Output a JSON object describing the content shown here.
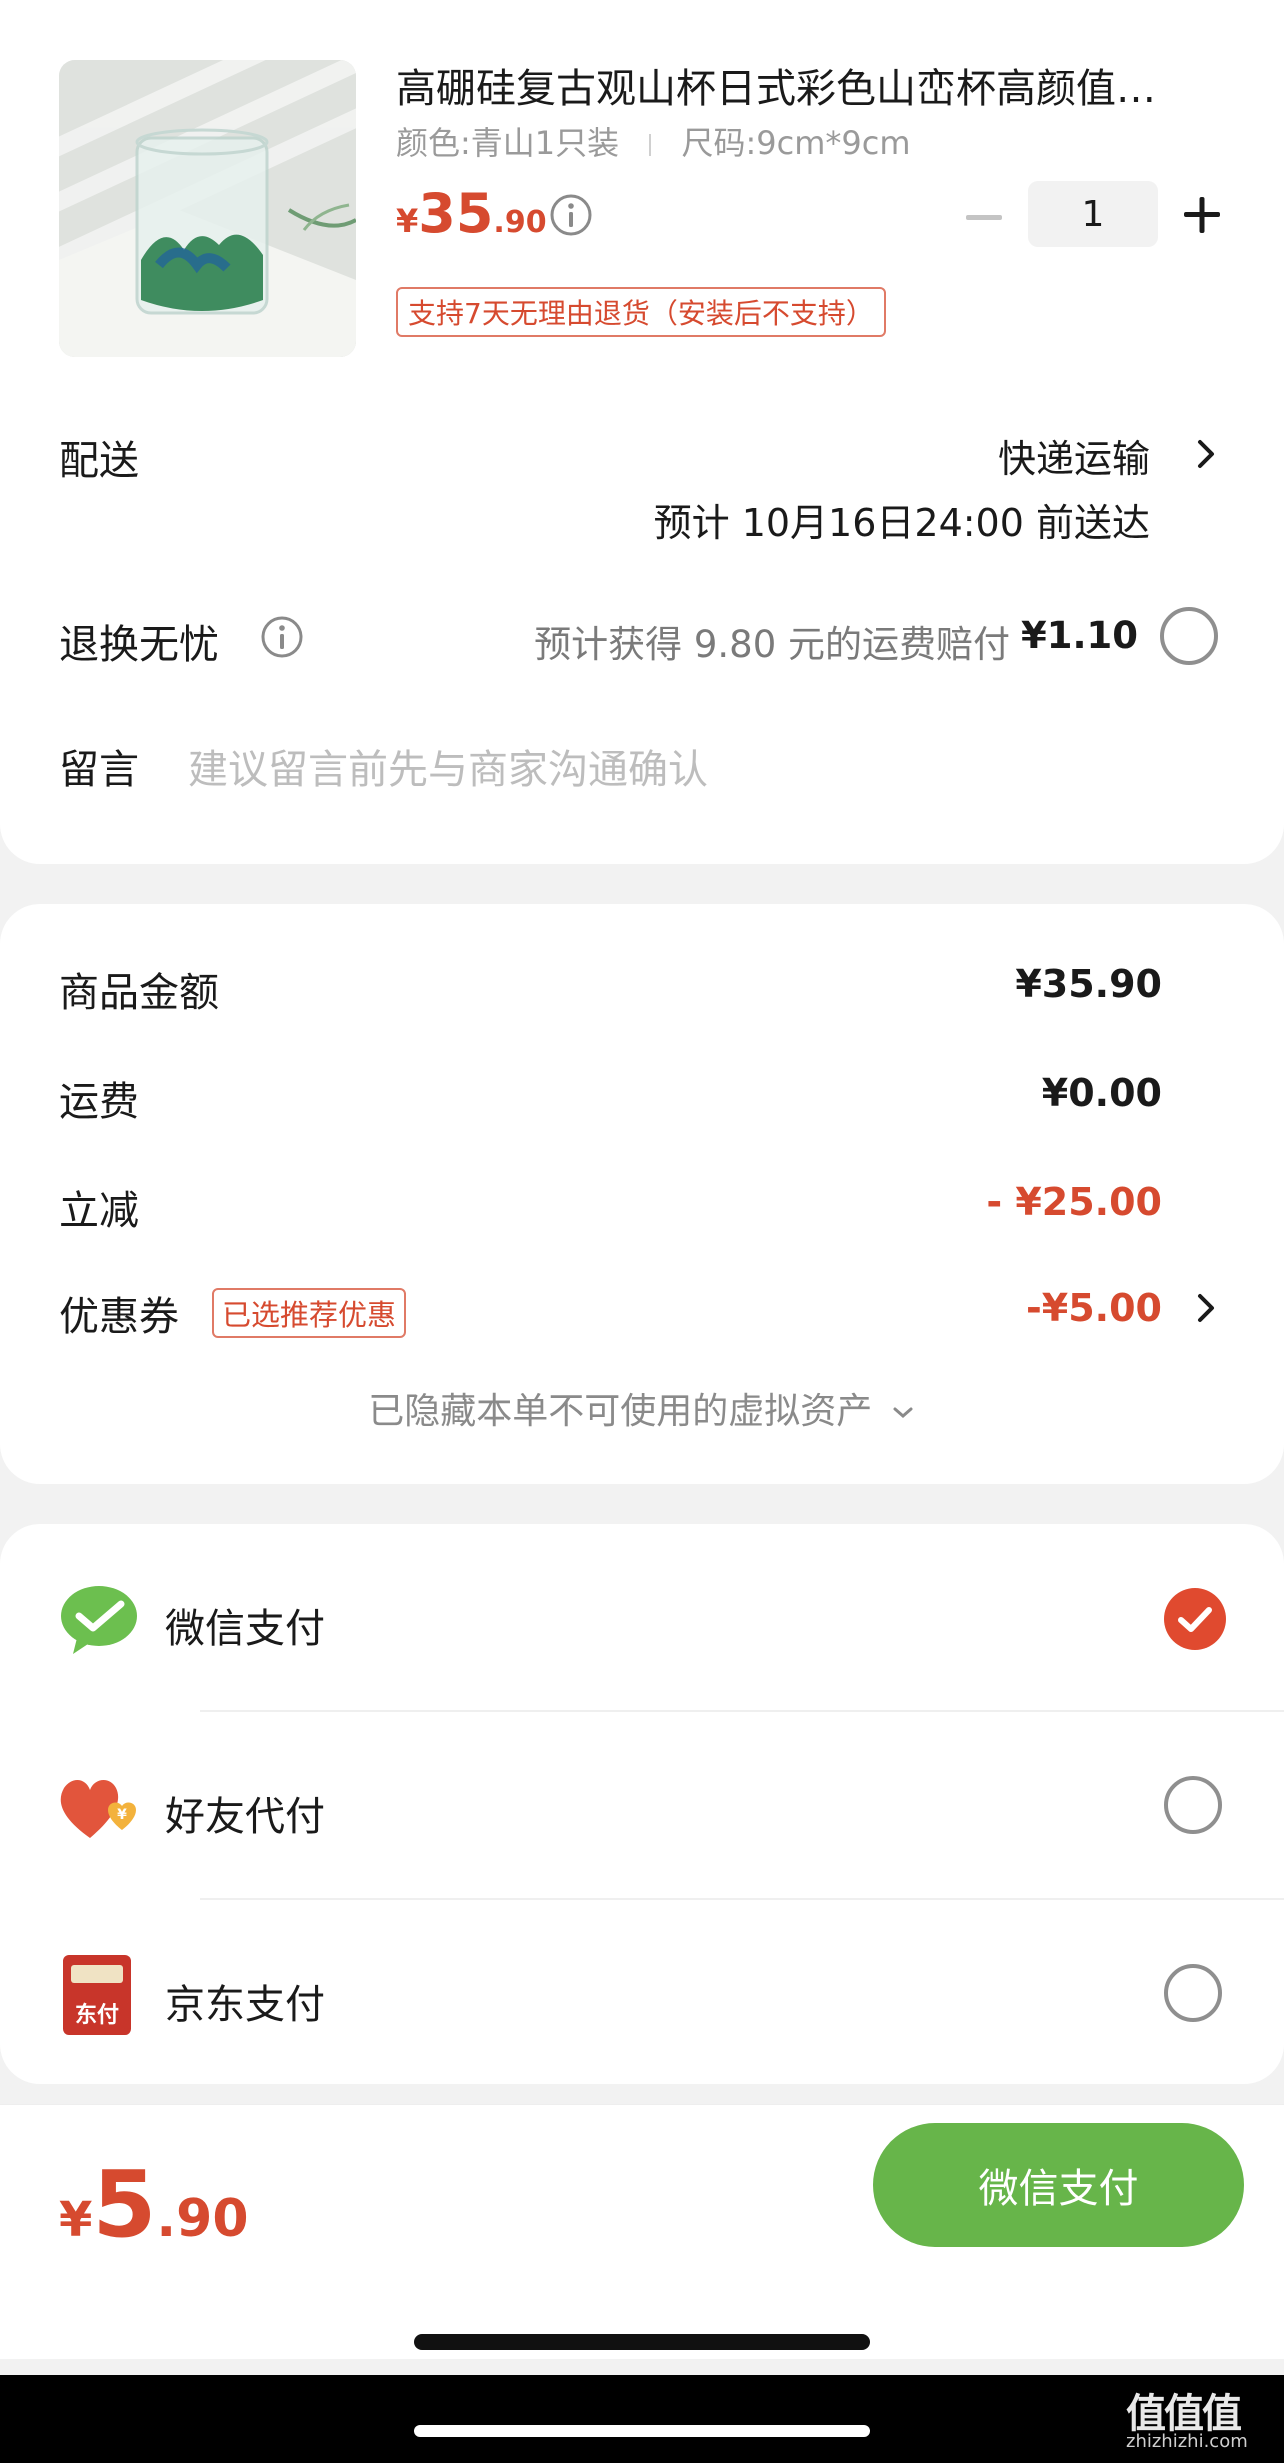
{
  "product": {
    "title": "高硼硅复古观山杯日式彩色山峦杯高颜值…",
    "color_spec": "颜色:青山1只装",
    "size_spec": "尺码:9cm*9cm",
    "currency": "¥",
    "price_int": "35",
    "price_dec": ".90",
    "quantity": "1",
    "return_policy": "支持7天无理由退货（安装后不支持）"
  },
  "delivery": {
    "label": "配送",
    "method": "快递运输",
    "eta": "预计 10月16日24:00 前送达"
  },
  "return_worry": {
    "label": "退换无忧",
    "desc": "预计获得 9.80 元的运费赔付",
    "price": "¥1.10"
  },
  "message": {
    "label": "留言",
    "placeholder": "建议留言前先与商家沟通确认"
  },
  "summary": {
    "goods_label": "商品金额",
    "goods_value": "¥35.90",
    "shipping_label": "运费",
    "shipping_value": "¥0.00",
    "discount_label": "立减",
    "discount_value": "- ¥25.00",
    "coupon_label": "优惠券",
    "coupon_badge": "已选推荐优惠",
    "coupon_value": "-¥5.00",
    "hidden_assets": "已隐藏本单不可使用的虚拟资产"
  },
  "payment": {
    "methods": [
      {
        "label": "微信支付",
        "icon": "wechat-pay-icon",
        "selected": true
      },
      {
        "label": "好友代付",
        "icon": "friend-pay-icon",
        "selected": false
      },
      {
        "label": "京东支付",
        "icon": "jd-pay-icon",
        "selected": false
      }
    ],
    "jd_icon_text": "东付",
    "friend_icon_text": "¥"
  },
  "footer": {
    "currency": "¥",
    "total_int": "5",
    "total_dec": ".90",
    "pay_button": "微信支付"
  },
  "watermark": {
    "logo": "值值值",
    "url": "zhizhizhi.com"
  },
  "colors": {
    "accent_red": "#d64a2f",
    "wechat_green": "#6cbf4f",
    "pay_button_green": "#67b54a"
  }
}
